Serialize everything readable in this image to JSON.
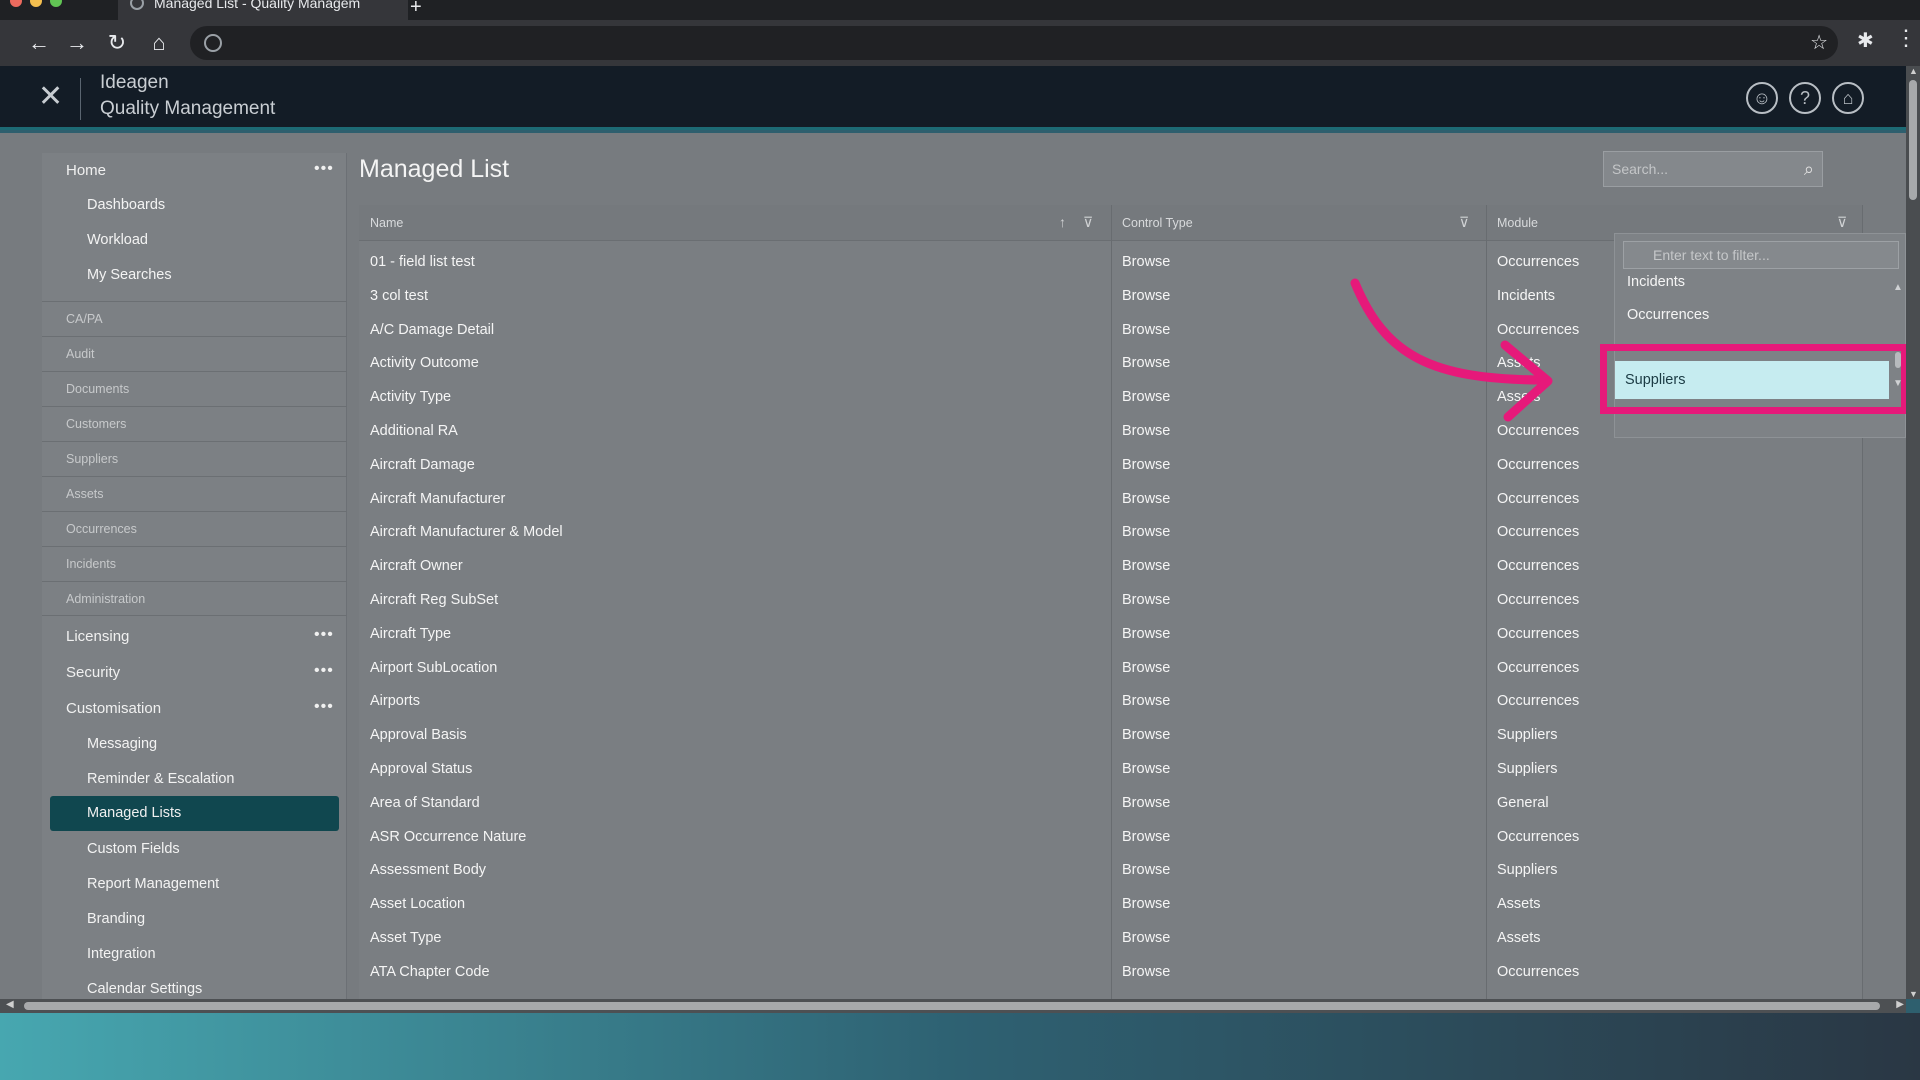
{
  "browser": {
    "tab_title": "Managed List - Quality Managem",
    "new_tab_icon": "plus-icon"
  },
  "app": {
    "brand_line1": "Ideagen",
    "brand_line2": "Quality Management",
    "header_icons": [
      "user-icon",
      "help-icon",
      "home-icon"
    ]
  },
  "sidebar": {
    "home": "Home",
    "home_children": [
      "Dashboards",
      "Workload",
      "My Searches"
    ],
    "categories": [
      "CA/PA",
      "Audit",
      "Documents",
      "Customers",
      "Suppliers",
      "Assets",
      "Occurrences",
      "Incidents",
      "Administration"
    ],
    "licensing": "Licensing",
    "security": "Security",
    "customisation": "Customisation",
    "customisation_children": [
      "Messaging",
      "Reminder & Escalation",
      "Managed Lists",
      "Custom Fields",
      "Report Management",
      "Branding",
      "Integration",
      "Calendar Settings"
    ],
    "active_item": "Managed Lists"
  },
  "main": {
    "title": "Managed List",
    "search_placeholder": "Search...",
    "columns": [
      "Name",
      "Control Type",
      "Module"
    ],
    "rows": [
      [
        "01 - field list test",
        "Browse",
        "Occurrences"
      ],
      [
        "3 col test",
        "Browse",
        "Incidents"
      ],
      [
        "A/C Damage Detail",
        "Browse",
        "Occurrences"
      ],
      [
        "Activity Outcome",
        "Browse",
        "Assets"
      ],
      [
        "Activity Type",
        "Browse",
        "Assets"
      ],
      [
        "Additional RA",
        "Browse",
        "Occurrences"
      ],
      [
        "Aircraft Damage",
        "Browse",
        "Occurrences"
      ],
      [
        "Aircraft Manufacturer",
        "Browse",
        "Occurrences"
      ],
      [
        "Aircraft Manufacturer & Model",
        "Browse",
        "Occurrences"
      ],
      [
        "Aircraft Owner",
        "Browse",
        "Occurrences"
      ],
      [
        "Aircraft Reg SubSet",
        "Browse",
        "Occurrences"
      ],
      [
        "Aircraft Type",
        "Browse",
        "Occurrences"
      ],
      [
        "Airport SubLocation",
        "Browse",
        "Occurrences"
      ],
      [
        "Airports",
        "Browse",
        "Occurrences"
      ],
      [
        "Approval Basis",
        "Browse",
        "Suppliers"
      ],
      [
        "Approval Status",
        "Browse",
        "Suppliers"
      ],
      [
        "Area of Standard",
        "Browse",
        "General"
      ],
      [
        "ASR Occurrence Nature",
        "Browse",
        "Occurrences"
      ],
      [
        "Assessment Body",
        "Browse",
        "Suppliers"
      ],
      [
        "Asset Location",
        "Browse",
        "Assets"
      ],
      [
        "Asset Type",
        "Browse",
        "Assets"
      ],
      [
        "ATA Chapter Code",
        "Browse",
        "Occurrences"
      ]
    ]
  },
  "dropdown": {
    "filter_placeholder": "Enter text to filter...",
    "options": [
      "Incidents",
      "Occurrences"
    ],
    "selected": "Suppliers"
  },
  "colors": {
    "accent_active": "#10474f",
    "highlight": "#e6197a",
    "selected_option_bg": "#c6ecf0"
  }
}
